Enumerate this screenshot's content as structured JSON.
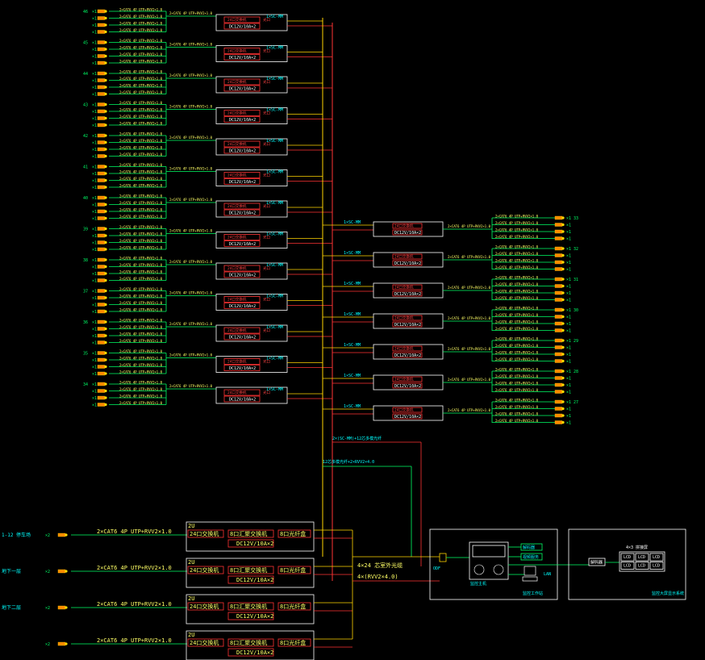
{
  "colors": {
    "background": "#000000",
    "cable_line": "#00ff66",
    "box_frame": "#ff3333",
    "label_yellow": "#ffff66",
    "label_cyan": "#00ffff",
    "panel_white": "#ffffff",
    "trunk_yellow": "#ffd400"
  },
  "icons": {
    "camera": "camera-icon",
    "workstation": "computer-icon",
    "nvr": "nvr-device-icon"
  },
  "left_floor_labels": [
    "46",
    "45",
    "44",
    "43",
    "42",
    "41",
    "40",
    "39",
    "38",
    "37",
    "36",
    "35",
    "34"
  ],
  "right_floor_labels": [
    "33",
    "32",
    "31",
    "30",
    "29",
    "28",
    "27"
  ],
  "camera_count_tag": "×1",
  "cable_spec": "2×CAT6 4P UTP+RVV2×1.0",
  "cabinet_main": "24口交换机",
  "cabinet_sub": "DC12V/10A×2",
  "cabinet_port": "光口",
  "cabinet_feed": "1×SC-MM",
  "bottom_rows": [
    {
      "left_label": "1-12 停车场",
      "count": "×2",
      "cable": "2×CAT6 4P UTP+RVV2×1.0",
      "cab_title": "2U",
      "b1": "24口交换机",
      "b2": "8口汇聚交换机",
      "b3": "8口光纤盒",
      "psu": "DC12V/10A×2"
    },
    {
      "left_label": "地下一层",
      "count": "×2",
      "cable": "2×CAT6 4P UTP+RVV2×1.0",
      "cab_title": "2U",
      "b1": "24口交换机",
      "b2": "8口汇聚交换机",
      "b3": "8口光纤盒",
      "psu": "DC12V/10A×2"
    },
    {
      "left_label": "地下二层",
      "count": "×2",
      "cable": "2×CAT6 4P UTP+RVV2×1.0",
      "cab_title": "2U",
      "b1": "24口交换机",
      "b2": "8口汇聚交换机",
      "b3": "8口光纤盒",
      "psu": "DC12V/10A×2"
    },
    {
      "left_label": "",
      "count": "×2",
      "cable": "2×CAT6 4P UTP+RVV2×1.0",
      "cab_title": "2U",
      "b1": "24口交换机",
      "b2": "8口汇聚交换机",
      "b3": "8口光纤盒",
      "psu": "DC12V/10A×2"
    }
  ],
  "trunk_labels": {
    "fiber": "4×24 芯室外光缆",
    "power": "4×(RVV2×4.0)",
    "riser1": "2×(SC-MM)+12芯多模光纤",
    "riser2": "12芯多模光纤+2×RVV2×4.0"
  },
  "control_room": {
    "nvr_label": "监控主机",
    "screen1": "解码器",
    "screen2": "视频服务",
    "workstation_label": "监控工作站",
    "odf_label": "ODF",
    "lan_label": "LAN"
  },
  "display_wall": {
    "title": "4×3 拼接屏",
    "cells": [
      "LCD",
      "LCD",
      "LCD",
      "LCD",
      "LCD",
      "LCD"
    ],
    "footer": "监控大屏显示系统",
    "decoder": "解码器"
  }
}
